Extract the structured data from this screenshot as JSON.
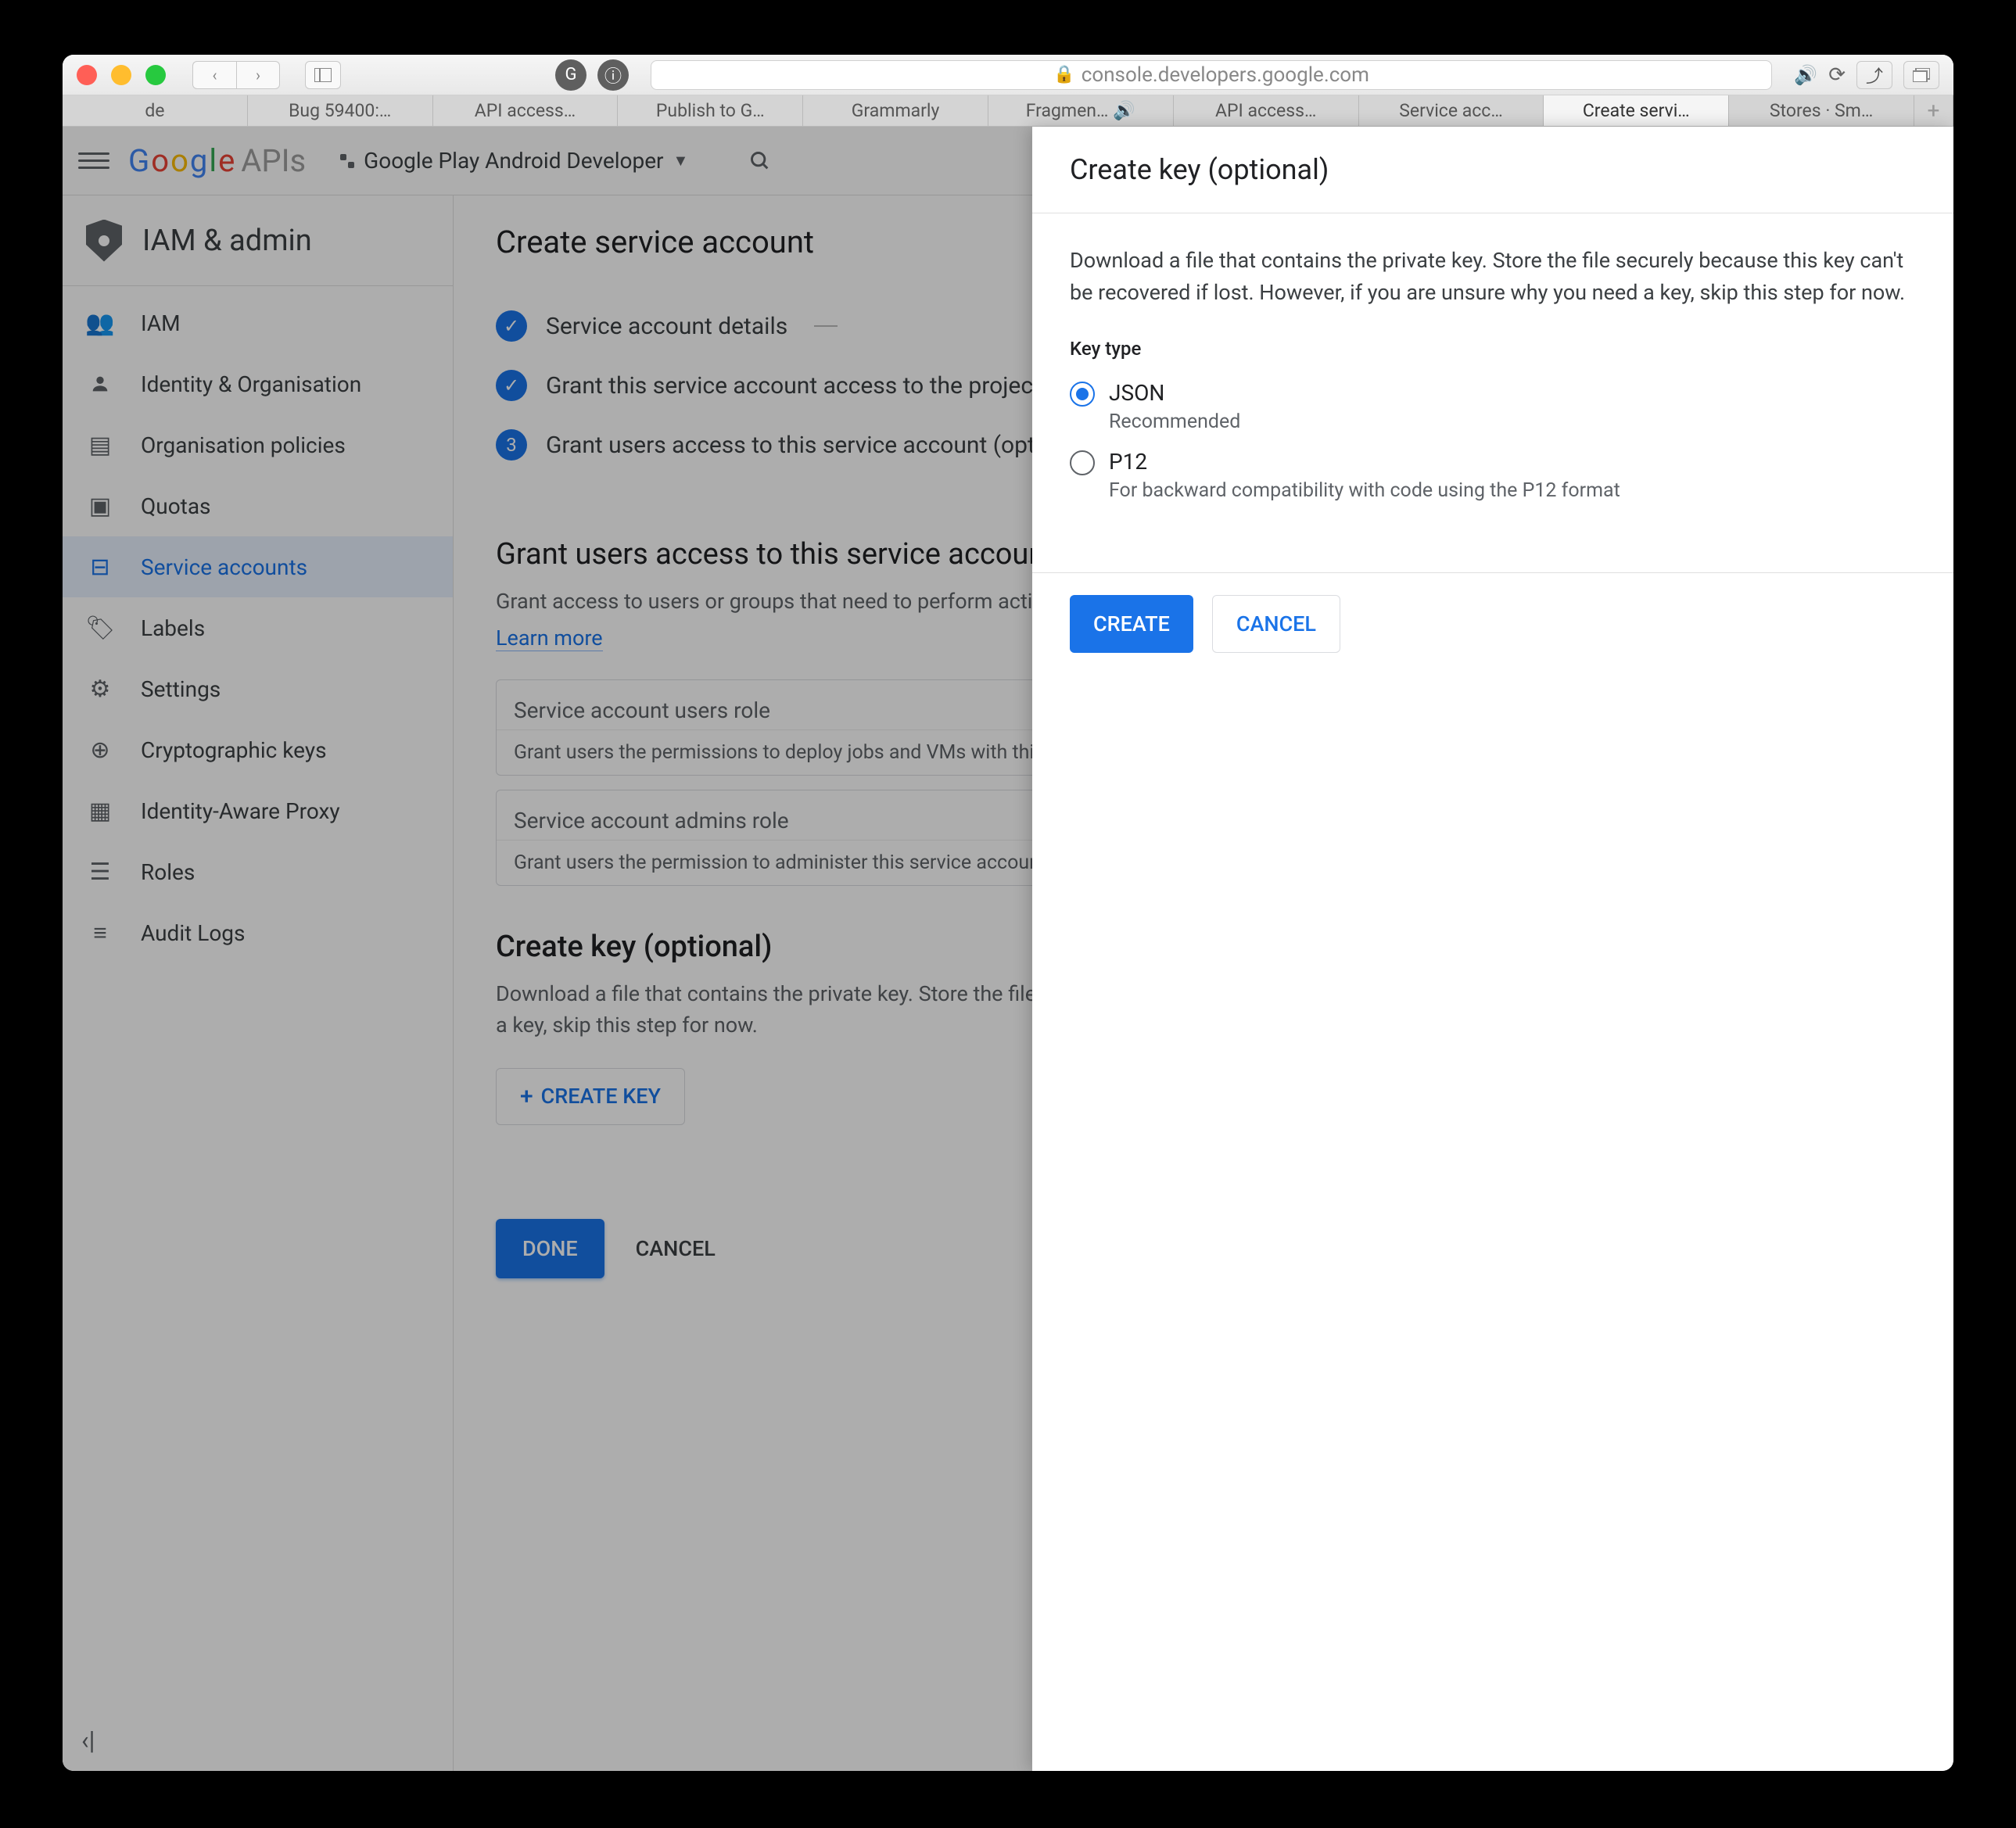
{
  "browser": {
    "url_host": "console.developers.google.com",
    "tabs": [
      "de",
      "Bug 59400:…",
      "API access…",
      "Publish to G…",
      "Grammarly",
      "Fragmen…",
      "API access…",
      "Service acc…",
      "Create servi…",
      "Stores · Sm…"
    ]
  },
  "appbar": {
    "logo_google": "Google",
    "logo_apis": "APIs",
    "project": "Google Play Android Developer"
  },
  "sidebar": {
    "title": "IAM & admin",
    "items": [
      {
        "label": "IAM"
      },
      {
        "label": "Identity & Organisation"
      },
      {
        "label": "Organisation policies"
      },
      {
        "label": "Quotas"
      },
      {
        "label": "Service accounts"
      },
      {
        "label": "Labels"
      },
      {
        "label": "Settings"
      },
      {
        "label": "Cryptographic keys"
      },
      {
        "label": "Identity-Aware Proxy"
      },
      {
        "label": "Roles"
      },
      {
        "label": "Audit Logs"
      }
    ]
  },
  "main": {
    "title": "Create service account",
    "steps": {
      "s1": "Service account details",
      "s2": "Grant this service account access to the project (optional)",
      "s3": "Grant users access to this service account (optional)",
      "s3num": "3"
    },
    "section1": {
      "title": "Grant users access to this service account (optional)",
      "desc": "Grant access to users or groups that need to perform actions as this service account.",
      "learn": "Learn more",
      "field1_label": "Service account users role",
      "field1_help": "Grant users the permissions to deploy jobs and VMs with this service account",
      "field2_label": "Service account admins role",
      "field2_help": "Grant users the permission to administer this service account"
    },
    "section2": {
      "title": "Create key (optional)",
      "desc": "Download a file that contains the private key. Store the file securely because this key can't be recovered if lost. However, if you are unsure why you need a key, skip this step for now.",
      "create_key": "CREATE KEY"
    },
    "done": "DONE",
    "cancel": "CANCEL"
  },
  "drawer": {
    "title": "Create key (optional)",
    "desc": "Download a file that contains the private key. Store the file securely because this key can't be recovered if lost. However, if you are unsure why you need a key, skip this step for now.",
    "keytype_label": "Key type",
    "json_label": "JSON",
    "json_help": "Recommended",
    "p12_label": "P12",
    "p12_help": "For backward compatibility with code using the P12 format",
    "create": "CREATE",
    "cancel": "CANCEL"
  }
}
